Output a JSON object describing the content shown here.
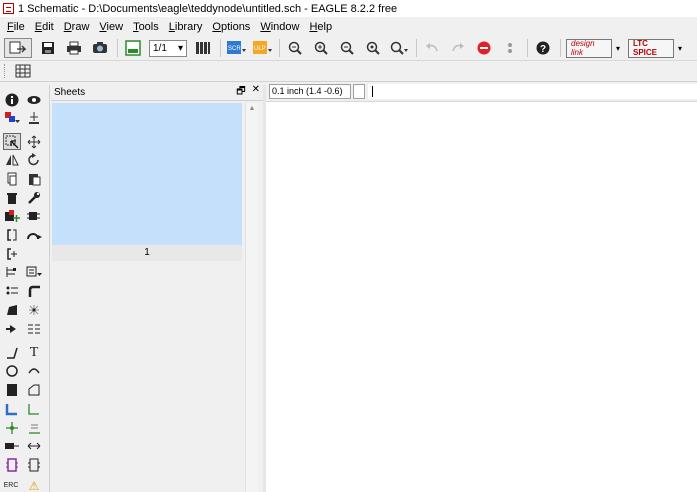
{
  "window": {
    "title": "1 Schematic - D:\\Documents\\eagle\\teddynode\\untitled.sch - EAGLE 8.2.2 free"
  },
  "menu": [
    {
      "label": "File",
      "u": "F",
      "rest": "ile"
    },
    {
      "label": "Edit",
      "u": "E",
      "rest": "dit"
    },
    {
      "label": "Draw",
      "u": "D",
      "rest": "raw"
    },
    {
      "label": "View",
      "u": "V",
      "rest": "iew"
    },
    {
      "label": "Tools",
      "u": "T",
      "rest": "ools"
    },
    {
      "label": "Library",
      "u": "L",
      "rest": "ibrary"
    },
    {
      "label": "Options",
      "u": "O",
      "rest": "ptions"
    },
    {
      "label": "Window",
      "u": "W",
      "rest": "indow"
    },
    {
      "label": "Help",
      "u": "H",
      "rest": "elp"
    }
  ],
  "toolbar": {
    "sheet_select": "1/1",
    "sheet_select_arrow": "▾",
    "design_link": "design link",
    "ltc_spice": "LTC SPICE",
    "scr": "SCR",
    "ulp": "ULP",
    "grid_icon": "grid-icon",
    "dropdown": "▾"
  },
  "sheets": {
    "title": "Sheets",
    "float_glyph": "🗗",
    "close_glyph": "✕",
    "items": [
      {
        "label": "1"
      }
    ],
    "scroll_up": "▲"
  },
  "status": {
    "coordinates": "0.1 inch (1.4 -0.6)",
    "command_value": ""
  },
  "tools": {
    "text": "T",
    "erc": "ERC",
    "warning": "⚠"
  },
  "colors": {
    "sheet_thumb": "#c5e0fb",
    "canvas": "#ffffff",
    "stop": "#e0202a"
  }
}
